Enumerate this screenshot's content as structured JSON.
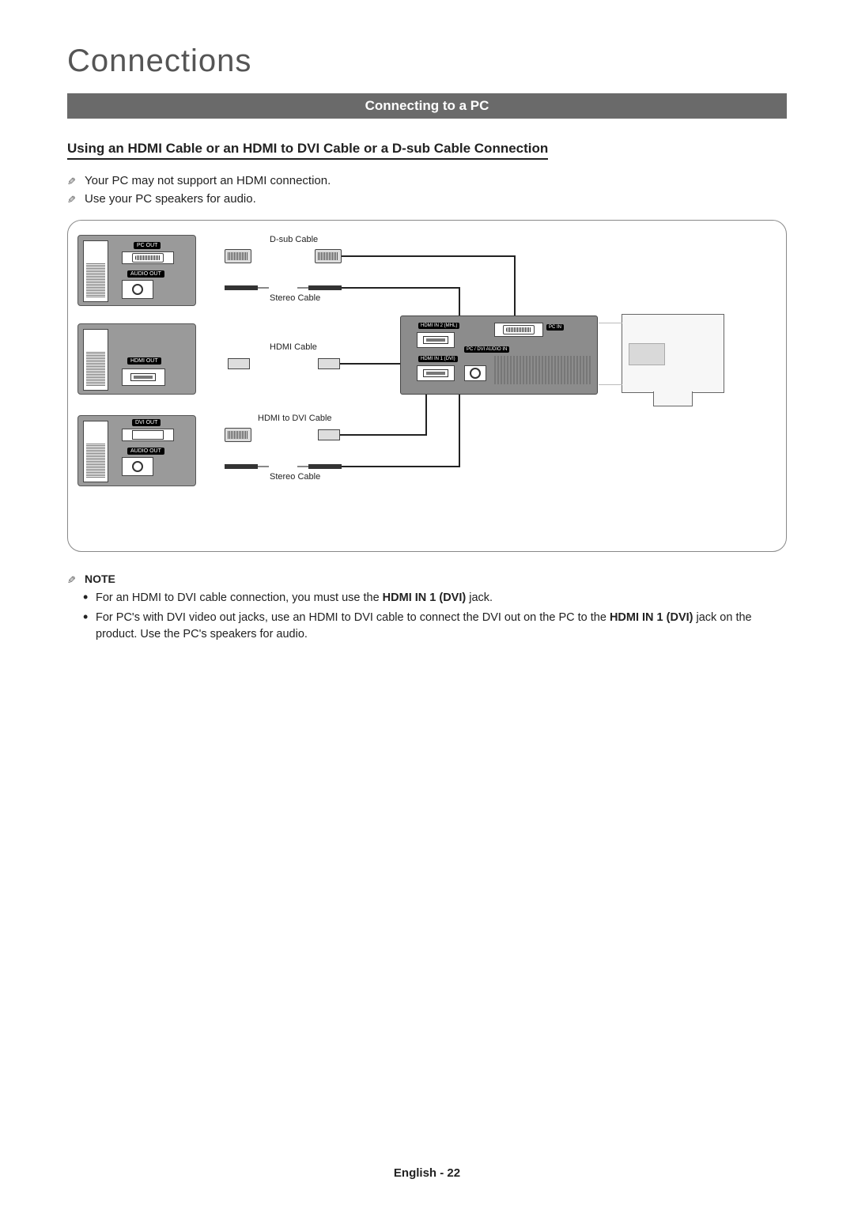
{
  "title": "Connections",
  "bar": "Connecting to a PC",
  "subheading": "Using an HDMI Cable or an HDMI to DVI Cable or a D-sub Cable Connection",
  "preNotes": [
    "Your PC may not support an HDMI connection.",
    "Use your PC speakers for audio."
  ],
  "diagram": {
    "pc1": {
      "port1": "PC OUT",
      "port2": "AUDIO OUT"
    },
    "pc2": {
      "port1": "HDMI OUT"
    },
    "pc3": {
      "port1": "DVI OUT",
      "port2": "AUDIO OUT"
    },
    "cableLabels": {
      "dsub": "D-sub Cable",
      "stereo1": "Stereo Cable",
      "hdmi": "HDMI Cable",
      "hdmi2dvi": "HDMI to DVI Cable",
      "stereo2": "Stereo Cable"
    },
    "tv": {
      "hdmi2": "HDMI IN 2 (MHL)",
      "hdmi1": "HDMI IN 1 (DVI)",
      "pcdvi_audio": "PC / DVI AUDIO IN",
      "pcin": "PC IN"
    }
  },
  "noteHeading": "NOTE",
  "notes": {
    "n1_a": "For an HDMI to DVI cable connection, you must use the ",
    "n1_b": "HDMI IN 1 (DVI)",
    "n1_c": " jack.",
    "n2_a": "For PC's with DVI video out jacks, use an HDMI to DVI cable to connect the DVI out on the PC to the ",
    "n2_b": "HDMI IN 1 (DVI)",
    "n2_c": " jack on the product. Use the PC's speakers for audio."
  },
  "footer": "English - 22"
}
